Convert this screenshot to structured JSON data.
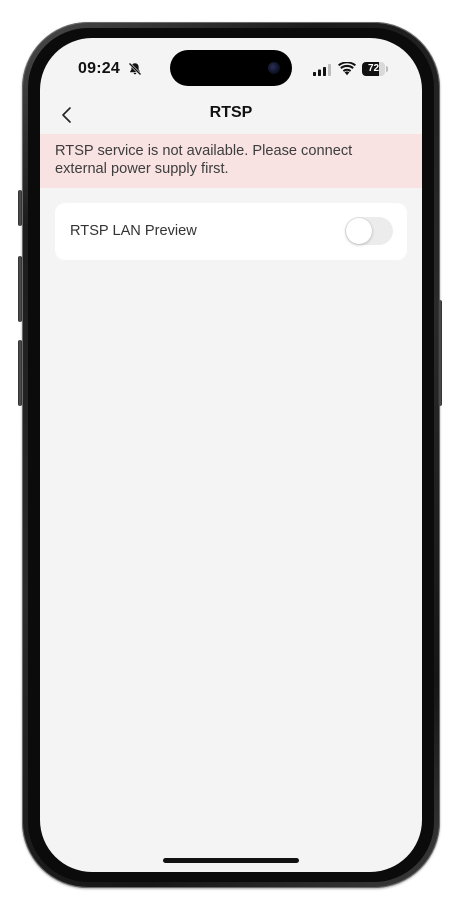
{
  "status_bar": {
    "time": "09:24",
    "silent_icon": "bell-slash-icon",
    "signal_icon": "cellular-signal-icon",
    "wifi_icon": "wifi-icon",
    "battery_level": "72",
    "battery_fraction": 0.72
  },
  "nav": {
    "back_icon": "chevron-left-icon",
    "title": "RTSP"
  },
  "banner": {
    "message": "RTSP service is not available. Please connect external power supply first.",
    "background_color": "#f8e2e2"
  },
  "settings": {
    "rtsp_lan_preview": {
      "label": "RTSP LAN Preview",
      "enabled": false
    }
  },
  "colors": {
    "screen_background": "#f4f4f4",
    "card_background": "#ffffff",
    "toggle_off_track": "#ececec"
  }
}
